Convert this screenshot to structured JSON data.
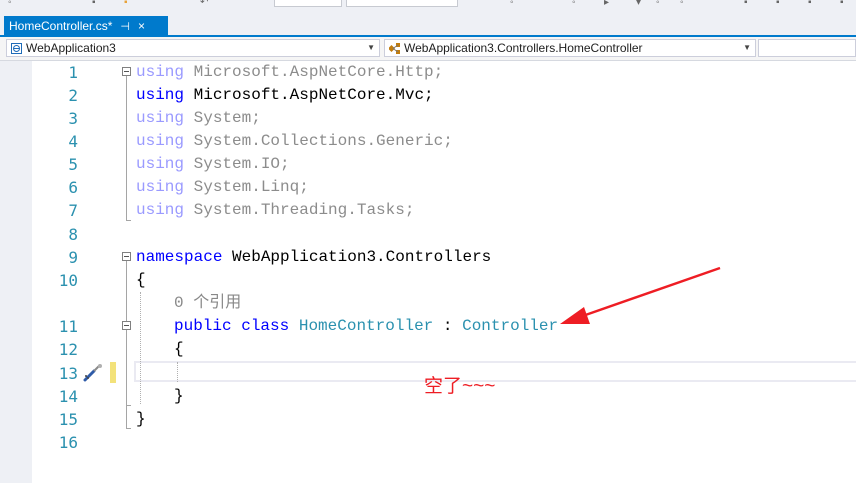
{
  "tab": {
    "title": "HomeController.cs*",
    "pin_glyph": "⊣",
    "close_glyph": "×"
  },
  "navbar": {
    "project": "WebApplication3",
    "class": "WebApplication3.Controllers.HomeController"
  },
  "editor": {
    "line_numbers": [
      "1",
      "2",
      "3",
      "4",
      "5",
      "6",
      "7",
      "8",
      "9",
      "10",
      "11",
      "12",
      "13",
      "14",
      "15",
      "16"
    ],
    "lines": [
      {
        "kw": "using",
        "rest": " Microsoft.AspNetCore.Http;",
        "dim": true
      },
      {
        "kw": "using",
        "rest": " Microsoft.AspNetCore.Mvc;",
        "dim": false
      },
      {
        "kw": "using",
        "rest": " System;",
        "dim": true
      },
      {
        "kw": "using",
        "rest": " System.Collections.Generic;",
        "dim": true
      },
      {
        "kw": "using",
        "rest": " System.IO;",
        "dim": true
      },
      {
        "kw": "using",
        "rest": " System.Linq;",
        "dim": true
      },
      {
        "kw": "using",
        "rest": " System.Threading.Tasks;",
        "dim": true
      }
    ],
    "namespace_kw": "namespace",
    "namespace_name": " WebApplication3.Controllers",
    "open_brace": "{",
    "close_brace": "}",
    "references": "0 个引用",
    "class_line": {
      "public": "public",
      "class": "class",
      "name": "HomeController",
      "colon": ":",
      "base": "Controller"
    },
    "class_open_brace": "{",
    "class_close_brace": "}"
  },
  "annotation": {
    "text": "空了~~~",
    "color": "#ee1d24"
  },
  "colors": {
    "accent": "#007acc",
    "keyword": "#0000ff",
    "type": "#2b91af",
    "line_number": "#2b91af",
    "annotation": "#ee1d24"
  },
  "icons": [
    "project-icon",
    "class-icon",
    "quick-action-screwdriver-icon",
    "collapse-icon"
  ]
}
